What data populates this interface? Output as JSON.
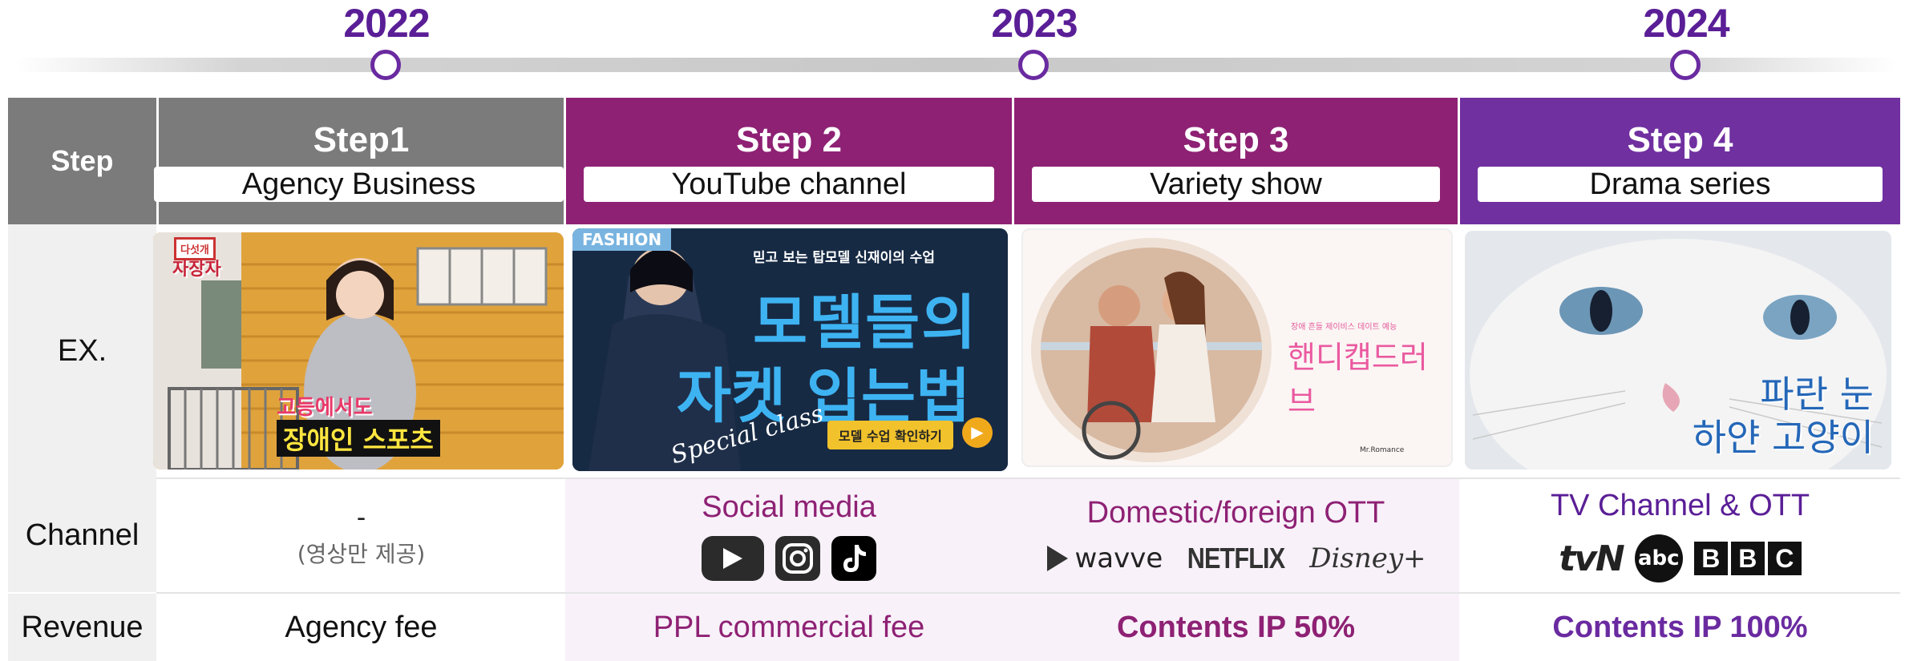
{
  "timeline": {
    "years": [
      "2022",
      "2023",
      "2024"
    ]
  },
  "table": {
    "header_label": "Step",
    "row_labels": {
      "ex": "EX.",
      "channel": "Channel",
      "revenue": "Revenue"
    },
    "steps": [
      {
        "title": "Step1",
        "subtitle": "Agency Business",
        "thumb_text": [
          "다섯개",
          "자장자",
          "고등에서도",
          "장애인 스포츠"
        ],
        "channel": "-",
        "channel_note": "(영상만 제공)",
        "revenue": "Agency fee"
      },
      {
        "title": "Step 2",
        "subtitle": "YouTube channel",
        "thumb_text": [
          "FASHION",
          "믿고 보는 탑모델 신재이의 수업",
          "모델들의",
          "자켓 입는법",
          "Special class",
          "모델 수업 확인하기"
        ],
        "channel": "Social media",
        "revenue": "PPL commercial fee"
      },
      {
        "title": "Step 3",
        "subtitle": "Variety show",
        "thumb_text": [
          "장애 흔들 제이비스 데이트 예능",
          "핸디캡드러브",
          "Mr.Romance"
        ],
        "channel": "Domestic/foreign OTT",
        "revenue": "Contents IP 50%"
      },
      {
        "title": "Step 4",
        "subtitle": "Drama series",
        "thumb_text": [
          "파란 눈",
          "하얀 고양이"
        ],
        "channel": "TV Channel & OTT",
        "revenue": "Contents IP 100%"
      }
    ],
    "logos": {
      "social": [
        "youtube-logo",
        "instagram-logo",
        "tiktok-logo"
      ],
      "ott": [
        "wavve",
        "NETFLIX",
        "Disney+"
      ],
      "tv": [
        "tvN",
        "abc",
        "BBC"
      ]
    }
  },
  "colors": {
    "purple_dark": "#5a1e96",
    "magenta": "#8e2174",
    "violet": "#7030a0",
    "gray_header": "#7b7b7b",
    "tint": "#f7f0f8"
  }
}
